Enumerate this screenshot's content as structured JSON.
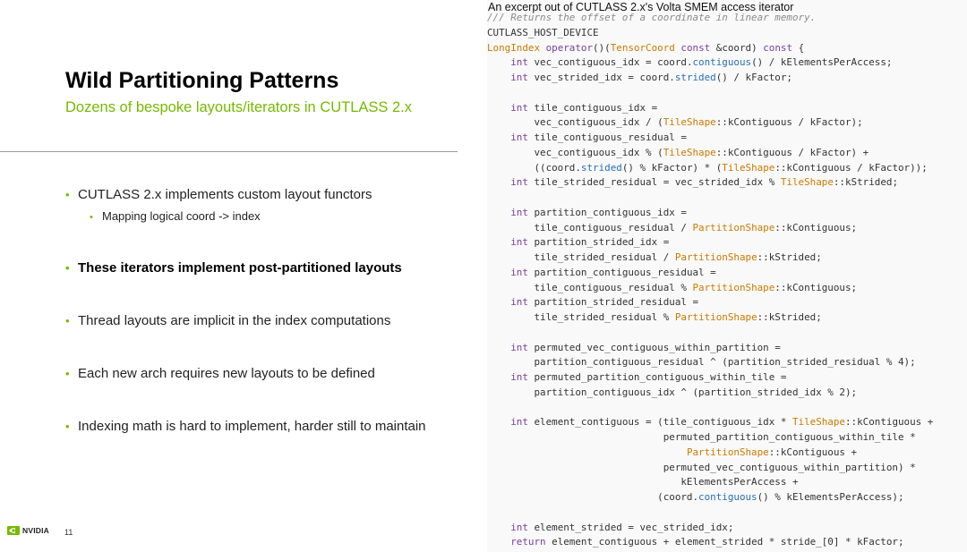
{
  "slide": {
    "title": "Wild Partitioning Patterns",
    "subtitle": "Dozens of bespoke layouts/iterators in CUTLASS 2.x",
    "bullets": [
      {
        "text": "CUTLASS 2.x implements custom layout functors",
        "sub": "Mapping logical coord -> index"
      },
      {
        "text": "These iterators implement post-partitioned layouts"
      },
      {
        "text": "Thread layouts are implicit in the index computations"
      },
      {
        "text": "Each new arch requires new layouts to be defined"
      },
      {
        "text": "Indexing math is hard to implement, harder still to maintain"
      }
    ],
    "bullet_marker": "•",
    "page_number": "11",
    "logo_text": "NVIDIA",
    "accent_color": "#76b900"
  },
  "code": {
    "caption": "An excerpt out of CUTLASS 2.x's Volta SMEM access iterator",
    "lines": [
      [
        {
          "t": "/// Returns the offset of a coordinate in linear memory.",
          "c": "cm"
        }
      ],
      [
        {
          "t": "CUTLASS_HOST_DEVICE",
          "c": "mc"
        }
      ],
      [
        {
          "t": "LongIndex",
          "c": "ty"
        },
        {
          "t": " "
        },
        {
          "t": "operator",
          "c": "kw"
        },
        {
          "t": "()("
        },
        {
          "t": "TensorCoord",
          "c": "ty"
        },
        {
          "t": " "
        },
        {
          "t": "const",
          "c": "kw"
        },
        {
          "t": " &coord) "
        },
        {
          "t": "const",
          "c": "kw"
        },
        {
          "t": " {"
        }
      ],
      [
        {
          "t": "    "
        },
        {
          "t": "int",
          "c": "kw"
        },
        {
          "t": " vec_contiguous_idx = coord."
        },
        {
          "t": "contiguous",
          "c": "fn"
        },
        {
          "t": "() / kElementsPerAccess;"
        }
      ],
      [
        {
          "t": "    "
        },
        {
          "t": "int",
          "c": "kw"
        },
        {
          "t": " vec_strided_idx = coord."
        },
        {
          "t": "strided",
          "c": "fn"
        },
        {
          "t": "() / kFactor;"
        }
      ],
      [
        {
          "t": ""
        }
      ],
      [
        {
          "t": "    "
        },
        {
          "t": "int",
          "c": "kw"
        },
        {
          "t": " tile_contiguous_idx ="
        }
      ],
      [
        {
          "t": "        vec_contiguous_idx / ("
        },
        {
          "t": "TileShape",
          "c": "ty"
        },
        {
          "t": "::kContiguous / kFactor);"
        }
      ],
      [
        {
          "t": "    "
        },
        {
          "t": "int",
          "c": "kw"
        },
        {
          "t": " tile_contiguous_residual ="
        }
      ],
      [
        {
          "t": "        vec_contiguous_idx % ("
        },
        {
          "t": "TileShape",
          "c": "ty"
        },
        {
          "t": "::kContiguous / kFactor) +"
        }
      ],
      [
        {
          "t": "        ((coord."
        },
        {
          "t": "strided",
          "c": "fn"
        },
        {
          "t": "() % kFactor) * ("
        },
        {
          "t": "TileShape",
          "c": "ty"
        },
        {
          "t": "::kContiguous / kFactor));"
        }
      ],
      [
        {
          "t": "    "
        },
        {
          "t": "int",
          "c": "kw"
        },
        {
          "t": " tile_strided_residual = vec_strided_idx % "
        },
        {
          "t": "TileShape",
          "c": "ty"
        },
        {
          "t": "::kStrided;"
        }
      ],
      [
        {
          "t": ""
        }
      ],
      [
        {
          "t": "    "
        },
        {
          "t": "int",
          "c": "kw"
        },
        {
          "t": " partition_contiguous_idx ="
        }
      ],
      [
        {
          "t": "        tile_contiguous_residual / "
        },
        {
          "t": "PartitionShape",
          "c": "ty"
        },
        {
          "t": "::kContiguous;"
        }
      ],
      [
        {
          "t": "    "
        },
        {
          "t": "int",
          "c": "kw"
        },
        {
          "t": " partition_strided_idx ="
        }
      ],
      [
        {
          "t": "        tile_strided_residual / "
        },
        {
          "t": "PartitionShape",
          "c": "ty"
        },
        {
          "t": "::kStrided;"
        }
      ],
      [
        {
          "t": "    "
        },
        {
          "t": "int",
          "c": "kw"
        },
        {
          "t": " partition_contiguous_residual ="
        }
      ],
      [
        {
          "t": "        tile_contiguous_residual % "
        },
        {
          "t": "PartitionShape",
          "c": "ty"
        },
        {
          "t": "::kContiguous;"
        }
      ],
      [
        {
          "t": "    "
        },
        {
          "t": "int",
          "c": "kw"
        },
        {
          "t": " partition_strided_residual ="
        }
      ],
      [
        {
          "t": "        tile_strided_residual % "
        },
        {
          "t": "PartitionShape",
          "c": "ty"
        },
        {
          "t": "::kStrided;"
        }
      ],
      [
        {
          "t": ""
        }
      ],
      [
        {
          "t": "    "
        },
        {
          "t": "int",
          "c": "kw"
        },
        {
          "t": " permuted_vec_contiguous_within_partition ="
        }
      ],
      [
        {
          "t": "        partition_contiguous_residual ^ (partition_strided_residual % 4);"
        }
      ],
      [
        {
          "t": "    "
        },
        {
          "t": "int",
          "c": "kw"
        },
        {
          "t": " permuted_partition_contiguous_within_tile ="
        }
      ],
      [
        {
          "t": "        partition_contiguous_idx ^ (partition_strided_idx % 2);"
        }
      ],
      [
        {
          "t": ""
        }
      ],
      [
        {
          "t": "    "
        },
        {
          "t": "int",
          "c": "kw"
        },
        {
          "t": " element_contiguous = (tile_contiguous_idx * "
        },
        {
          "t": "TileShape",
          "c": "ty"
        },
        {
          "t": "::kContiguous +"
        }
      ],
      [
        {
          "t": "                              permuted_partition_contiguous_within_tile *"
        }
      ],
      [
        {
          "t": "                                  "
        },
        {
          "t": "PartitionShape",
          "c": "ty"
        },
        {
          "t": "::kContiguous +"
        }
      ],
      [
        {
          "t": "                              permuted_vec_contiguous_within_partition) *"
        }
      ],
      [
        {
          "t": "                                 kElementsPerAccess +"
        }
      ],
      [
        {
          "t": "                             (coord."
        },
        {
          "t": "contiguous",
          "c": "fn"
        },
        {
          "t": "() % kElementsPerAccess);"
        }
      ],
      [
        {
          "t": ""
        }
      ],
      [
        {
          "t": "    "
        },
        {
          "t": "int",
          "c": "kw"
        },
        {
          "t": " element_strided = vec_strided_idx;"
        }
      ],
      [
        {
          "t": "    "
        },
        {
          "t": "return",
          "c": "kw"
        },
        {
          "t": " element_contiguous + element_strided * stride_[0] * kFactor;"
        }
      ]
    ]
  }
}
